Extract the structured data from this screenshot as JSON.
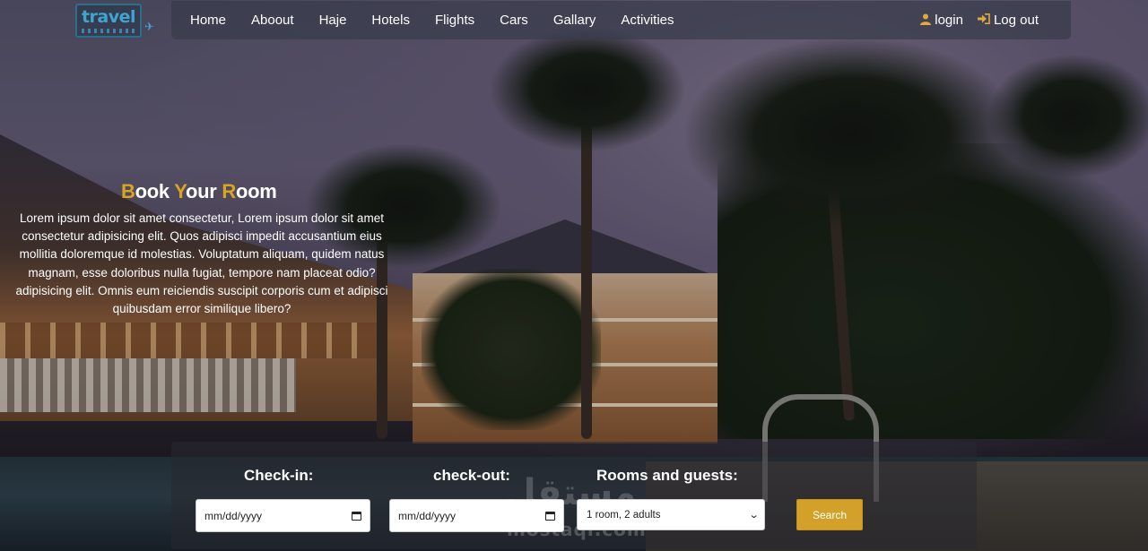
{
  "logo": {
    "text": "travel",
    "icon": "plane-icon"
  },
  "nav": {
    "items": [
      {
        "label": "Home"
      },
      {
        "label": "Aboout"
      },
      {
        "label": "Haje"
      },
      {
        "label": "Hotels"
      },
      {
        "label": "Flights"
      },
      {
        "label": "Cars"
      },
      {
        "label": "Gallary"
      },
      {
        "label": "Activities"
      }
    ],
    "login": {
      "label": "login",
      "icon": "user-icon"
    },
    "logout": {
      "label": "Log out",
      "icon": "sign-in-icon"
    }
  },
  "hero": {
    "title_parts": [
      "B",
      "ook ",
      "Y",
      "our ",
      "R",
      "oom"
    ],
    "body": "Lorem ipsum dolor sit amet consectetur, Lorem ipsum dolor sit amet consectetur adipisicing elit. Quos adipisci impedit accusantium eius mollitia doloremque id molestias. Voluptatum aliquam, quidem natus magnam, esse doloribus nulla fugiat, tempore nam placeat odio?adipisicing elit. Omnis eum reiciendis suscipit corporis cum et adipisci quibusdam error similique libero?"
  },
  "booking": {
    "checkin_label": "Check-in:",
    "checkout_label": "check-out:",
    "rooms_label": "Rooms and guests:",
    "checkin_placeholder": "mm/dd/yyyy",
    "checkout_placeholder": "mm/dd/yyyy",
    "rooms_value": "1 room, 2 adults",
    "search_label": "Search"
  },
  "watermark": {
    "main": "مستقل",
    "sub": "mostaql.com"
  },
  "colors": {
    "accent": "#d9a521",
    "button": "#d3a12a",
    "logo": "#3fa4cf"
  }
}
